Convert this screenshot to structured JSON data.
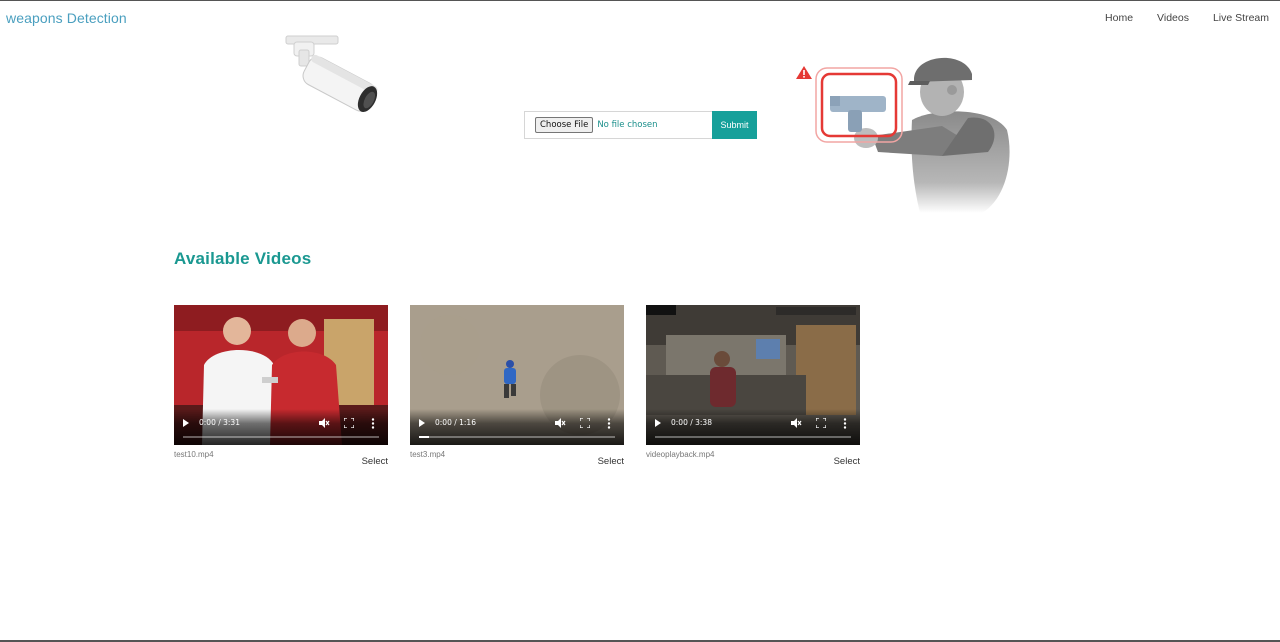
{
  "navbar": {
    "brand": "weapons Detection",
    "links": [
      "Home",
      "Videos",
      "Live Stream"
    ]
  },
  "upload": {
    "choose_label": "Choose File",
    "status": "No file chosen",
    "submit_label": "Submit"
  },
  "section": {
    "title": "Available Videos"
  },
  "videos": [
    {
      "time": "0:00 / 3:31",
      "filename": "test10.mp4",
      "select_label": "Select",
      "progress": 0.0
    },
    {
      "time": "0:00 / 1:16",
      "filename": "test3.mp4",
      "select_label": "Select",
      "progress": 0.05
    },
    {
      "time": "0:00 / 3:38",
      "filename": "videoplayback.mp4",
      "select_label": "Select",
      "progress": 0.0
    }
  ],
  "colors": {
    "brand": "#4a9fbf",
    "accent": "#16a09a",
    "heading": "#1a9891",
    "alert": "#e53935"
  }
}
